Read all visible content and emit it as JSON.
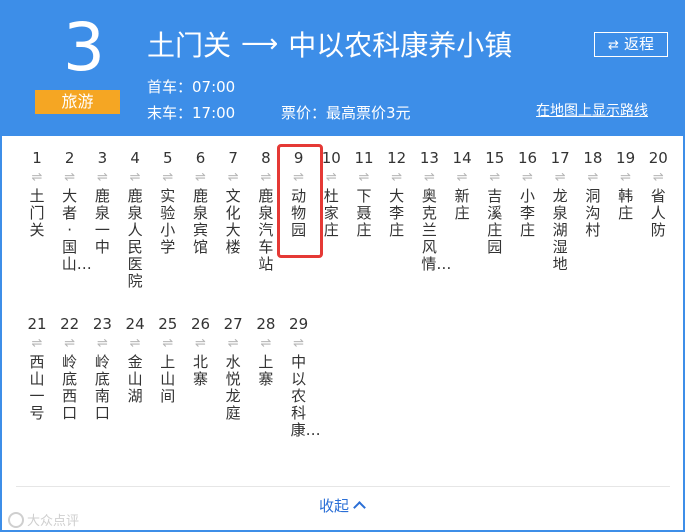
{
  "route": {
    "number": "3",
    "badge": "旅游"
  },
  "direction": {
    "from": "土门关",
    "arrow": "⟶",
    "to": "中以农科康养小镇"
  },
  "return_button": {
    "icon": "⇄",
    "label": "返程"
  },
  "schedule": {
    "first_bus": "首车：07:00",
    "last_bus": "末车：17:00",
    "fare": "票价：最高票价3元"
  },
  "map_link": "在地图上显示路线",
  "stop_icon": "⇌",
  "stops_row1": [
    {
      "num": "1",
      "name": "土门关"
    },
    {
      "num": "2",
      "name": "大者·国山…"
    },
    {
      "num": "3",
      "name": "鹿泉一中"
    },
    {
      "num": "4",
      "name": "鹿泉人民医院"
    },
    {
      "num": "5",
      "name": "实验小学"
    },
    {
      "num": "6",
      "name": "鹿泉宾馆"
    },
    {
      "num": "7",
      "name": "文化大楼"
    },
    {
      "num": "8",
      "name": "鹿泉汽车站"
    },
    {
      "num": "9",
      "name": "动物园"
    },
    {
      "num": "10",
      "name": "杜家庄"
    },
    {
      "num": "11",
      "name": "下聂庄"
    },
    {
      "num": "12",
      "name": "大李庄"
    },
    {
      "num": "13",
      "name": "奥克兰风情…"
    },
    {
      "num": "14",
      "name": "新庄"
    },
    {
      "num": "15",
      "name": "吉溪庄园"
    },
    {
      "num": "16",
      "name": "小李庄"
    },
    {
      "num": "17",
      "name": "龙泉湖湿地"
    },
    {
      "num": "18",
      "name": "洞沟村"
    },
    {
      "num": "19",
      "name": "韩庄"
    },
    {
      "num": "20",
      "name": "省人防"
    }
  ],
  "stops_row2": [
    {
      "num": "21",
      "name": "西山一号"
    },
    {
      "num": "22",
      "name": "岭底西口"
    },
    {
      "num": "23",
      "name": "岭底南口"
    },
    {
      "num": "24",
      "name": "金山湖"
    },
    {
      "num": "25",
      "name": "上山间"
    },
    {
      "num": "26",
      "name": "北寨"
    },
    {
      "num": "27",
      "name": "水悦龙庭"
    },
    {
      "num": "28",
      "name": "上寨"
    },
    {
      "num": "29",
      "name": "中以农科康…"
    }
  ],
  "highlighted_stop": "9",
  "collapse_label": "收起",
  "watermark": "大众点评",
  "colors": {
    "header": "#3d8ee8",
    "badge": "#f5a623",
    "highlight": "#e53935",
    "link": "#2b6fd6"
  }
}
